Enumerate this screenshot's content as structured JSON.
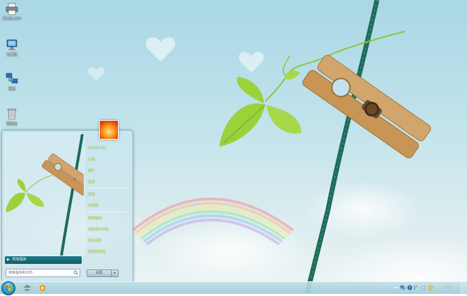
{
  "desktop": {
    "icons": [
      {
        "label": "51obj.com",
        "icon": "printer-icon"
      },
      {
        "label": "计算机",
        "icon": "computer-icon"
      },
      {
        "label": "网络",
        "icon": "network-icon"
      },
      {
        "label": "回收站",
        "icon": "recycle-bin-icon"
      }
    ]
  },
  "start_menu": {
    "all_programs_label": "所有程序",
    "search_placeholder": "搜索程序和文件",
    "right_items": [
      "51obj.com",
      "文档",
      "图片",
      "音乐",
      "游戏",
      "计算机",
      "控制面板",
      "设备和打印机",
      "默认程序",
      "帮助和支持"
    ],
    "shutdown_label": "关机",
    "shutdown_arrow": "▸"
  },
  "taskbar": {
    "clock": "4:25"
  },
  "colors": {
    "menu_text": "#d6f06a",
    "sky": "#a9d7e5",
    "rope": "#1f6a5a"
  }
}
